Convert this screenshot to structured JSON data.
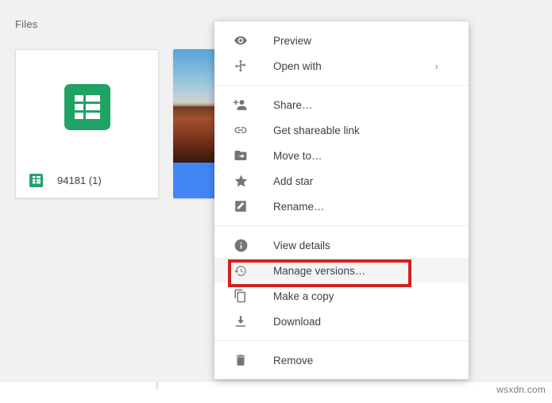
{
  "app": {
    "section_title": "Files",
    "watermark": "wsxdn.com",
    "accent_blue": "#4285f4",
    "sheets_green": "#21a366",
    "annotation_red": "#d32020",
    "menu_bg": "#ffffff",
    "highlight_bg": "#f5f5f5",
    "surface_bg": "#f1f1f1"
  },
  "files": [
    {
      "name": "94181 (1)",
      "type_icon": "google-sheets-icon",
      "thumbnail": "sheets-document-thumbnail"
    },
    {
      "name": "",
      "type_icon": "google-photos-icon",
      "thumbnail": "desert-landscape-photo"
    }
  ],
  "context_menu": {
    "groups": [
      {
        "items": [
          {
            "label": "Preview",
            "icon": "eye-icon",
            "submenu": false,
            "highlighted": false
          },
          {
            "label": "Open with",
            "icon": "open-with-move-icon",
            "submenu": true,
            "submenu_glyph": "›",
            "highlighted": false
          }
        ]
      },
      {
        "items": [
          {
            "label": "Share…",
            "icon": "person-add-icon",
            "submenu": false,
            "highlighted": false
          },
          {
            "label": "Get shareable link",
            "icon": "link-icon",
            "submenu": false,
            "highlighted": false
          },
          {
            "label": "Move to…",
            "icon": "folder-move-icon",
            "submenu": false,
            "highlighted": false
          },
          {
            "label": "Add star",
            "icon": "star-icon",
            "submenu": false,
            "highlighted": false
          },
          {
            "label": "Rename…",
            "icon": "pencil-rename-icon",
            "submenu": false,
            "highlighted": false
          }
        ]
      },
      {
        "items": [
          {
            "label": "View details",
            "icon": "info-icon",
            "submenu": false,
            "highlighted": false
          },
          {
            "label": "Manage versions…",
            "icon": "history-restore-icon",
            "submenu": false,
            "highlighted": true
          },
          {
            "label": "Make a copy",
            "icon": "copy-icon",
            "submenu": false,
            "highlighted": false
          },
          {
            "label": "Download",
            "icon": "download-icon",
            "submenu": false,
            "highlighted": false
          }
        ]
      },
      {
        "items": [
          {
            "label": "Remove",
            "icon": "trash-icon",
            "submenu": false,
            "highlighted": false
          }
        ]
      }
    ]
  }
}
